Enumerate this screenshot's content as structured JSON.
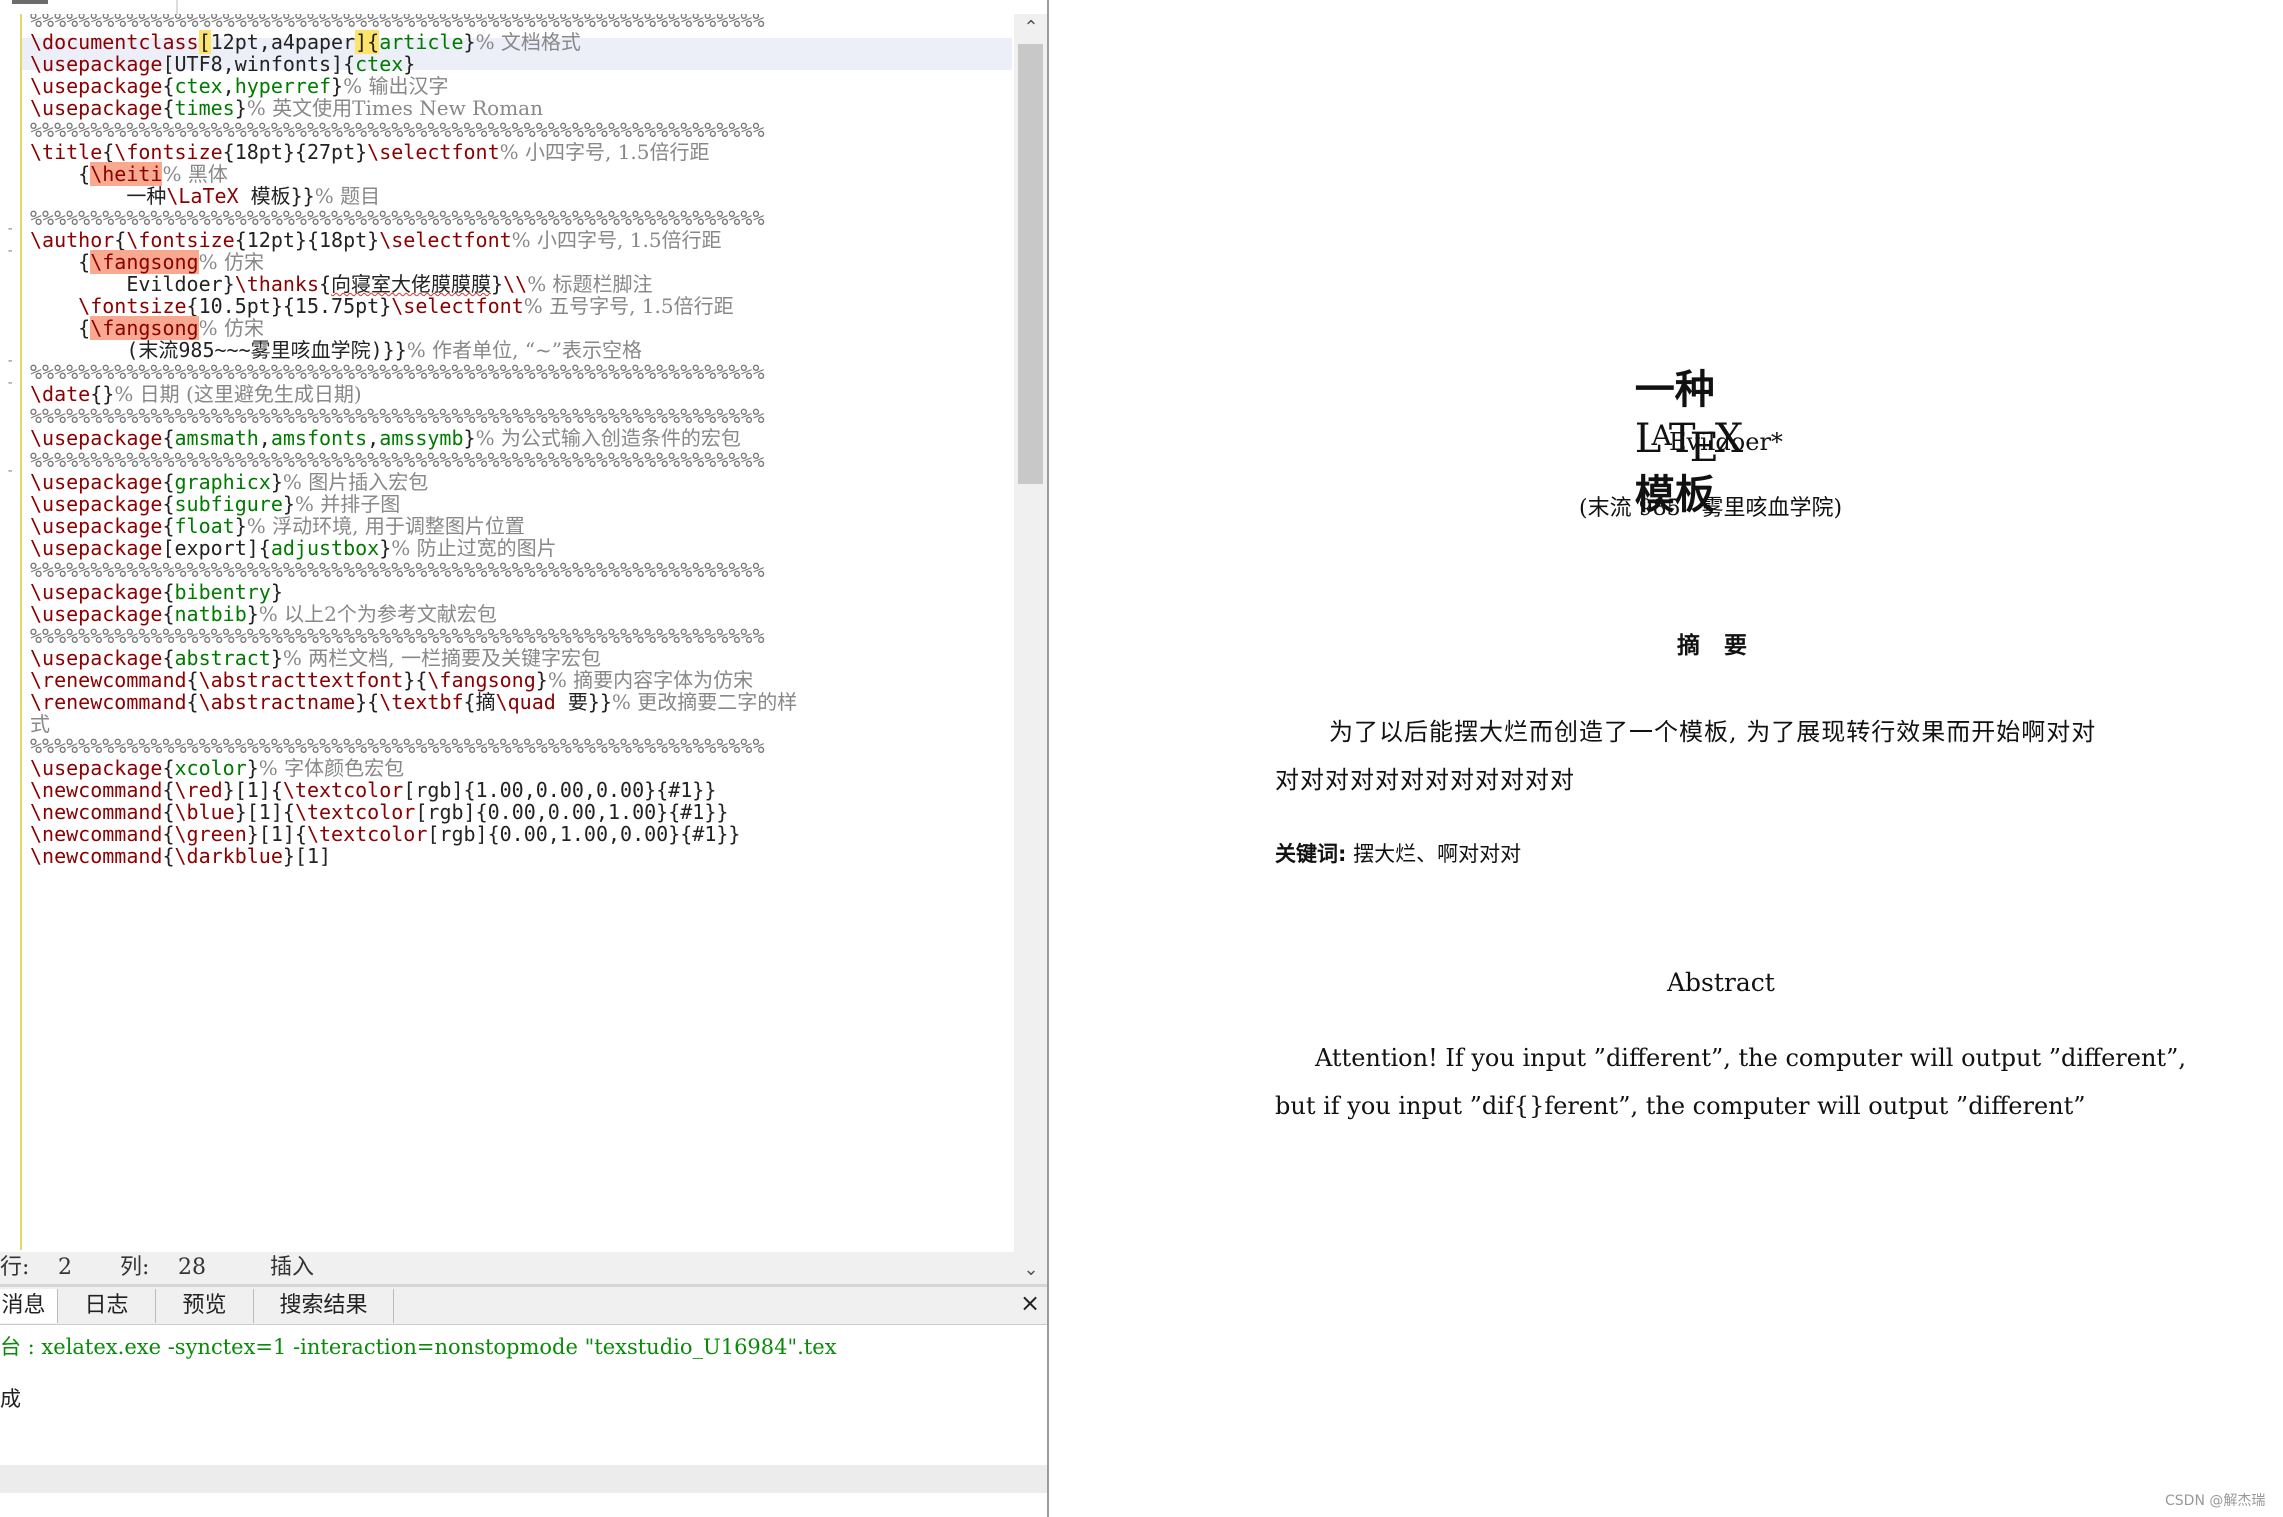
{
  "editor": {
    "lines": [
      [
        {
          "t": "%%%%%%%%%%%%%%%%%%%%%%%%%%%%%%%%%%%%%%%%%%%%%%%%%%%%%%%%%%%%%",
          "c": "pct"
        }
      ],
      [
        {
          "t": "\\documentclass",
          "c": "cmd"
        },
        {
          "t": "[",
          "c": "hlbr"
        },
        {
          "t": "12pt,a4paper"
        },
        {
          "t": "]",
          "c": "hlbr"
        },
        {
          "t": "{",
          "c": "hlbr"
        },
        {
          "t": "article",
          "c": "arg"
        },
        {
          "t": "}"
        },
        {
          "t": "% 文档格式",
          "c": "cmt"
        }
      ],
      [
        {
          "t": "\\usepackage",
          "c": "cmd"
        },
        {
          "t": "[UTF8,winfonts]{"
        },
        {
          "t": "ctex",
          "c": "arg"
        },
        {
          "t": "}"
        }
      ],
      [
        {
          "t": "\\usepackage",
          "c": "cmd"
        },
        {
          "t": "{"
        },
        {
          "t": "ctex",
          "c": "arg"
        },
        {
          "t": ","
        },
        {
          "t": "hyperref",
          "c": "arg"
        },
        {
          "t": "}"
        },
        {
          "t": "% 输出汉字",
          "c": "cmt"
        }
      ],
      [
        {
          "t": "\\usepackage",
          "c": "cmd"
        },
        {
          "t": "{"
        },
        {
          "t": "times",
          "c": "arg"
        },
        {
          "t": "}"
        },
        {
          "t": "% 英文使用Times New Roman",
          "c": "cmt"
        }
      ],
      [
        {
          "t": "%%%%%%%%%%%%%%%%%%%%%%%%%%%%%%%%%%%%%%%%%%%%%%%%%%%%%%%%%%%%%",
          "c": "pct"
        }
      ],
      [
        {
          "t": "\\title",
          "c": "cmd"
        },
        {
          "t": "{"
        },
        {
          "t": "\\fontsize",
          "c": "cmd"
        },
        {
          "t": "{18pt}{27pt}"
        },
        {
          "t": "\\selectfont",
          "c": "cmd"
        },
        {
          "t": "% 小四字号, 1.5倍行距",
          "c": "cmt"
        }
      ],
      [
        {
          "t": "    {"
        },
        {
          "t": "\\heiti",
          "c": "cmd hl"
        },
        {
          "t": "% 黑体",
          "c": "cmt"
        }
      ],
      [
        {
          "t": "        一种"
        },
        {
          "t": "\\LaTeX",
          "c": "cmd"
        },
        {
          "t": " 模板}}"
        },
        {
          "t": "% 题目",
          "c": "cmt"
        }
      ],
      [
        {
          "t": "%%%%%%%%%%%%%%%%%%%%%%%%%%%%%%%%%%%%%%%%%%%%%%%%%%%%%%%%%%%%%",
          "c": "pct"
        }
      ],
      [
        {
          "t": "\\author",
          "c": "cmd"
        },
        {
          "t": "{"
        },
        {
          "t": "\\fontsize",
          "c": "cmd"
        },
        {
          "t": "{12pt}{18pt}"
        },
        {
          "t": "\\selectfont",
          "c": "cmd"
        },
        {
          "t": "% 小四字号, 1.5倍行距",
          "c": "cmt"
        }
      ],
      [
        {
          "t": "    {"
        },
        {
          "t": "\\fangsong",
          "c": "cmd hl"
        },
        {
          "t": "% 仿宋",
          "c": "cmt"
        }
      ],
      [
        {
          "t": "        Evildoer}"
        },
        {
          "t": "\\thanks",
          "c": "cmd"
        },
        {
          "t": "{"
        },
        {
          "t": "向寝室大佬膜膜膜",
          "c": "wavy"
        },
        {
          "t": "}"
        },
        {
          "t": "\\\\",
          "c": "cmd"
        },
        {
          "t": "% 标题栏脚注",
          "c": "cmt"
        }
      ],
      [
        {
          "t": "    "
        },
        {
          "t": "\\fontsize",
          "c": "cmd"
        },
        {
          "t": "{10.5pt}{15.75pt}"
        },
        {
          "t": "\\selectfont",
          "c": "cmd"
        },
        {
          "t": "% 五号字号, 1.5倍行距",
          "c": "cmt"
        }
      ],
      [
        {
          "t": "    {"
        },
        {
          "t": "\\fangsong",
          "c": "cmd hl"
        },
        {
          "t": "% 仿宋",
          "c": "cmt"
        }
      ],
      [
        {
          "t": "        (末流985~~~雾里咳血学院)}}"
        },
        {
          "t": "% 作者单位, “~”表示空格",
          "c": "cmt"
        }
      ],
      [
        {
          "t": "%%%%%%%%%%%%%%%%%%%%%%%%%%%%%%%%%%%%%%%%%%%%%%%%%%%%%%%%%%%%%",
          "c": "pct"
        }
      ],
      [
        {
          "t": "\\date",
          "c": "cmd"
        },
        {
          "t": "{}"
        },
        {
          "t": "% 日期 (这里避免生成日期)",
          "c": "cmt"
        }
      ],
      [
        {
          "t": "%%%%%%%%%%%%%%%%%%%%%%%%%%%%%%%%%%%%%%%%%%%%%%%%%%%%%%%%%%%%%",
          "c": "pct"
        }
      ],
      [
        {
          "t": "\\usepackage",
          "c": "cmd"
        },
        {
          "t": "{"
        },
        {
          "t": "amsmath",
          "c": "arg"
        },
        {
          "t": ","
        },
        {
          "t": "amsfonts",
          "c": "arg"
        },
        {
          "t": ","
        },
        {
          "t": "amssymb",
          "c": "arg"
        },
        {
          "t": "}"
        },
        {
          "t": "% 为公式输入创造条件的宏包",
          "c": "cmt"
        }
      ],
      [
        {
          "t": "%%%%%%%%%%%%%%%%%%%%%%%%%%%%%%%%%%%%%%%%%%%%%%%%%%%%%%%%%%%%%",
          "c": "pct"
        }
      ],
      [
        {
          "t": "\\usepackage",
          "c": "cmd"
        },
        {
          "t": "{"
        },
        {
          "t": "graphicx",
          "c": "arg"
        },
        {
          "t": "}"
        },
        {
          "t": "% 图片插入宏包",
          "c": "cmt"
        }
      ],
      [
        {
          "t": "\\usepackage",
          "c": "cmd"
        },
        {
          "t": "{"
        },
        {
          "t": "subfigure",
          "c": "arg"
        },
        {
          "t": "}"
        },
        {
          "t": "% 并排子图",
          "c": "cmt"
        }
      ],
      [
        {
          "t": "\\usepackage",
          "c": "cmd"
        },
        {
          "t": "{"
        },
        {
          "t": "float",
          "c": "arg"
        },
        {
          "t": "}"
        },
        {
          "t": "% 浮动环境, 用于调整图片位置",
          "c": "cmt"
        }
      ],
      [
        {
          "t": "\\usepackage",
          "c": "cmd"
        },
        {
          "t": "[export]{"
        },
        {
          "t": "adjustbox",
          "c": "arg"
        },
        {
          "t": "}"
        },
        {
          "t": "% 防止过宽的图片",
          "c": "cmt"
        }
      ],
      [
        {
          "t": "%%%%%%%%%%%%%%%%%%%%%%%%%%%%%%%%%%%%%%%%%%%%%%%%%%%%%%%%%%%%%",
          "c": "pct"
        }
      ],
      [
        {
          "t": "\\usepackage",
          "c": "cmd"
        },
        {
          "t": "{"
        },
        {
          "t": "bibentry",
          "c": "arg"
        },
        {
          "t": "}"
        }
      ],
      [
        {
          "t": "\\usepackage",
          "c": "cmd"
        },
        {
          "t": "{"
        },
        {
          "t": "natbib",
          "c": "arg"
        },
        {
          "t": "}"
        },
        {
          "t": "% 以上2个为参考文献宏包",
          "c": "cmt"
        }
      ],
      [
        {
          "t": "%%%%%%%%%%%%%%%%%%%%%%%%%%%%%%%%%%%%%%%%%%%%%%%%%%%%%%%%%%%%%",
          "c": "pct"
        }
      ],
      [
        {
          "t": "\\usepackage",
          "c": "cmd"
        },
        {
          "t": "{"
        },
        {
          "t": "abstract",
          "c": "arg"
        },
        {
          "t": "}"
        },
        {
          "t": "% 两栏文档, 一栏摘要及关键字宏包",
          "c": "cmt"
        }
      ],
      [
        {
          "t": "\\renewcommand",
          "c": "cmd"
        },
        {
          "t": "{"
        },
        {
          "t": "\\abstracttextfont",
          "c": "cmd"
        },
        {
          "t": "}{"
        },
        {
          "t": "\\fangsong",
          "c": "cmd"
        },
        {
          "t": "}"
        },
        {
          "t": "% 摘要内容字体为仿宋",
          "c": "cmt"
        }
      ],
      [
        {
          "t": "\\renewcommand",
          "c": "cmd"
        },
        {
          "t": "{"
        },
        {
          "t": "\\abstractname",
          "c": "cmd"
        },
        {
          "t": "}{"
        },
        {
          "t": "\\textbf",
          "c": "cmd"
        },
        {
          "t": "{摘"
        },
        {
          "t": "\\quad",
          "c": "cmd"
        },
        {
          "t": " 要}}"
        },
        {
          "t": "% 更改摘要二字的样",
          "c": "cmt"
        }
      ],
      [
        {
          "t": "式",
          "c": "cmt"
        }
      ],
      [
        {
          "t": "%%%%%%%%%%%%%%%%%%%%%%%%%%%%%%%%%%%%%%%%%%%%%%%%%%%%%%%%%%%%%",
          "c": "pct"
        }
      ],
      [
        {
          "t": "\\usepackage",
          "c": "cmd"
        },
        {
          "t": "{"
        },
        {
          "t": "xcolor",
          "c": "arg"
        },
        {
          "t": "}"
        },
        {
          "t": "% 字体颜色宏包",
          "c": "cmt"
        }
      ],
      [
        {
          "t": "\\newcommand",
          "c": "cmd"
        },
        {
          "t": "{"
        },
        {
          "t": "\\red",
          "c": "cmd"
        },
        {
          "t": "}[1]{"
        },
        {
          "t": "\\textcolor",
          "c": "cmd"
        },
        {
          "t": "[rgb]{1.00,0.00,0.00}{#1}}"
        }
      ],
      [
        {
          "t": "\\newcommand",
          "c": "cmd"
        },
        {
          "t": "{"
        },
        {
          "t": "\\blue",
          "c": "cmd"
        },
        {
          "t": "}[1]{"
        },
        {
          "t": "\\textcolor",
          "c": "cmd"
        },
        {
          "t": "[rgb]{0.00,0.00,1.00}{#1}}"
        }
      ],
      [
        {
          "t": "\\newcommand",
          "c": "cmd"
        },
        {
          "t": "{"
        },
        {
          "t": "\\green",
          "c": "cmd"
        },
        {
          "t": "}[1]{"
        },
        {
          "t": "\\textcolor",
          "c": "cmd"
        },
        {
          "t": "[rgb]{0.00,1.00,0.00}{#1}}"
        }
      ],
      [
        {
          "t": "\\newcommand",
          "c": "cmd"
        },
        {
          "t": "{"
        },
        {
          "t": "\\darkblue",
          "c": "cmd"
        },
        {
          "t": "}[1]"
        }
      ]
    ]
  },
  "status": {
    "row_label": "行:",
    "row_value": "2",
    "col_label": "列:",
    "col_value": "28",
    "mode": "插入"
  },
  "messages": {
    "tabs": [
      "消息",
      "日志",
      "预览",
      "搜索结果"
    ],
    "active_tab": 0,
    "close": "×",
    "log_lines": [
      "台 : xelatex.exe -synctex=1 -interaction=nonstopmode \"texstudio_U16984\".tex",
      "成"
    ]
  },
  "preview": {
    "title_pre": "一种",
    "title_latex": {
      "L": "L",
      "A": "A",
      "T": "T",
      "E": "E",
      "X": "X"
    },
    "title_post": "模板",
    "author": "Evildoer*",
    "affiliation": "(末流 985   雾里咳血学院)",
    "abstract_heading": "摘   要",
    "abstract_line1": "为了以后能摆大烂而创造了一个模板, 为了展现转行效果而开始啊对对",
    "abstract_line2": "对对对对对对对对对对对对",
    "keywords_label": "关键词:",
    "keywords_text": "摆大烂、啊对对对",
    "abstract_en_heading": "Abstract",
    "abstract_en_line1": "Attention! If you input ”different”, the computer will output ”different”,",
    "abstract_en_line2": "but if you input ”dif{}ferent”, the computer will output ”different”",
    "watermark": "CSDN @解杰瑞"
  },
  "colors": {
    "command": "#8b0000",
    "argument": "#007a00",
    "comment": "#888888",
    "highlight": "#f9a98f",
    "bracket": "#ffe46b",
    "current_line": "#eceef8"
  }
}
